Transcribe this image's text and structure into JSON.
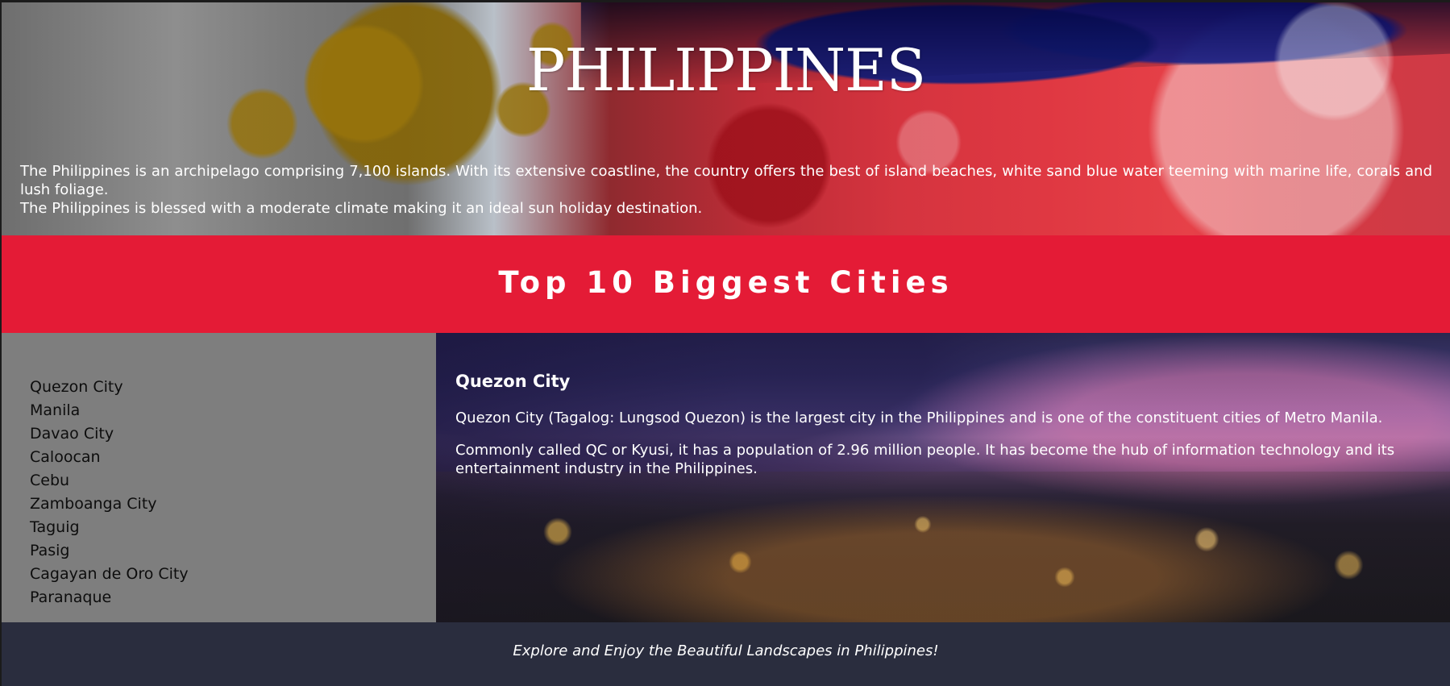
{
  "header": {
    "title": "PHILIPPINES",
    "intro_line1": "The Philippines is an archipelago comprising 7,100 islands. With its extensive coastline, the country offers the best of island beaches, white sand blue water teeming with marine life, corals and lush foliage.",
    "intro_line2": "The Philippines is blessed with a moderate climate making it an ideal sun holiday destination."
  },
  "banner": {
    "heading": "Top 10 Biggest Cities"
  },
  "cities": [
    "Quezon City",
    "Manila",
    "Davao City",
    "Caloocan",
    "Cebu",
    "Zamboanga City",
    "Taguig",
    "Pasig",
    "Cagayan de Oro City",
    "Paranaque"
  ],
  "detail": {
    "city_name": "Quezon City",
    "paragraph1": "Quezon City (Tagalog: Lungsod Quezon) is the largest city in the Philippines and is one of the constituent cities of Metro Manila.",
    "paragraph2": "Commonly called QC or Kyusi, it has a population of 2.96 million people. It has become the hub of information technology and its entertainment industry in the Philippines."
  },
  "footer": {
    "tagline": "Explore and Enjoy the Beautiful Landscapes in Philippines!"
  },
  "colors": {
    "banner_red": "#e41b36",
    "sidebar_gray": "#7e7e7e",
    "footer_navy": "#2a2d3e"
  }
}
